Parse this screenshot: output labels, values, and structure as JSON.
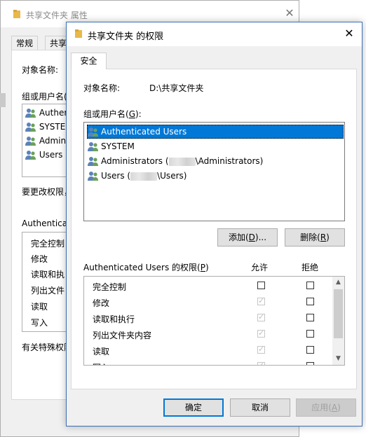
{
  "background_window": {
    "title": "共享文件夹 属性",
    "tabs": [
      "常规",
      "共享"
    ],
    "object_label": "对象名称:",
    "group_label": "组或用户名(",
    "users": [
      "Authen",
      "SYSTEM",
      "Admini",
      "Users ("
    ],
    "change_perm_text": "要更改权限，",
    "perm_header": "Authenticat",
    "perms": [
      "完全控制",
      "修改",
      "读取和执",
      "列出文件",
      "读取",
      "写入"
    ],
    "special_text": "有关特殊权限"
  },
  "dialog": {
    "title": "共享文件夹 的权限",
    "tab": "安全",
    "object_name_label": "对象名称:",
    "object_name_value": "D:\\共享文件夹",
    "group_label": "组或用户名(",
    "group_label_key": "G",
    "group_label_end": "):",
    "users": [
      {
        "pre": "Authenticated Users",
        "post": "",
        "selected": true
      },
      {
        "pre": "SYSTEM",
        "post": "",
        "selected": false
      },
      {
        "pre": "Administrators (",
        "post": "\\Administrators)",
        "selected": false
      },
      {
        "pre": "Users (",
        "post": "\\Users)",
        "selected": false
      }
    ],
    "add_button": "添加(",
    "add_key": "D",
    "add_end": ")...",
    "remove_button": "删除(",
    "remove_key": "R",
    "remove_end": ")",
    "perm_header_label": "Authenticated Users 的权限(",
    "perm_header_key": "P",
    "perm_header_end": ")",
    "allow_label": "允许",
    "deny_label": "拒绝",
    "permissions": [
      {
        "name": "完全控制",
        "allow": false,
        "allow_inherited": false,
        "deny": false
      },
      {
        "name": "修改",
        "allow": true,
        "allow_inherited": true,
        "deny": false
      },
      {
        "name": "读取和执行",
        "allow": true,
        "allow_inherited": true,
        "deny": false
      },
      {
        "name": "列出文件夹内容",
        "allow": true,
        "allow_inherited": true,
        "deny": false
      },
      {
        "name": "读取",
        "allow": true,
        "allow_inherited": true,
        "deny": false
      },
      {
        "name": "写入",
        "allow": true,
        "allow_inherited": true,
        "deny": false
      }
    ],
    "ok_button": "确定",
    "cancel_button": "取消",
    "apply_button": "应用(",
    "apply_key": "A",
    "apply_end": ")"
  },
  "colors": {
    "selection": "#0078d7",
    "default_button_border": "#0078d7",
    "dialog_border": "#3b6fb6"
  }
}
